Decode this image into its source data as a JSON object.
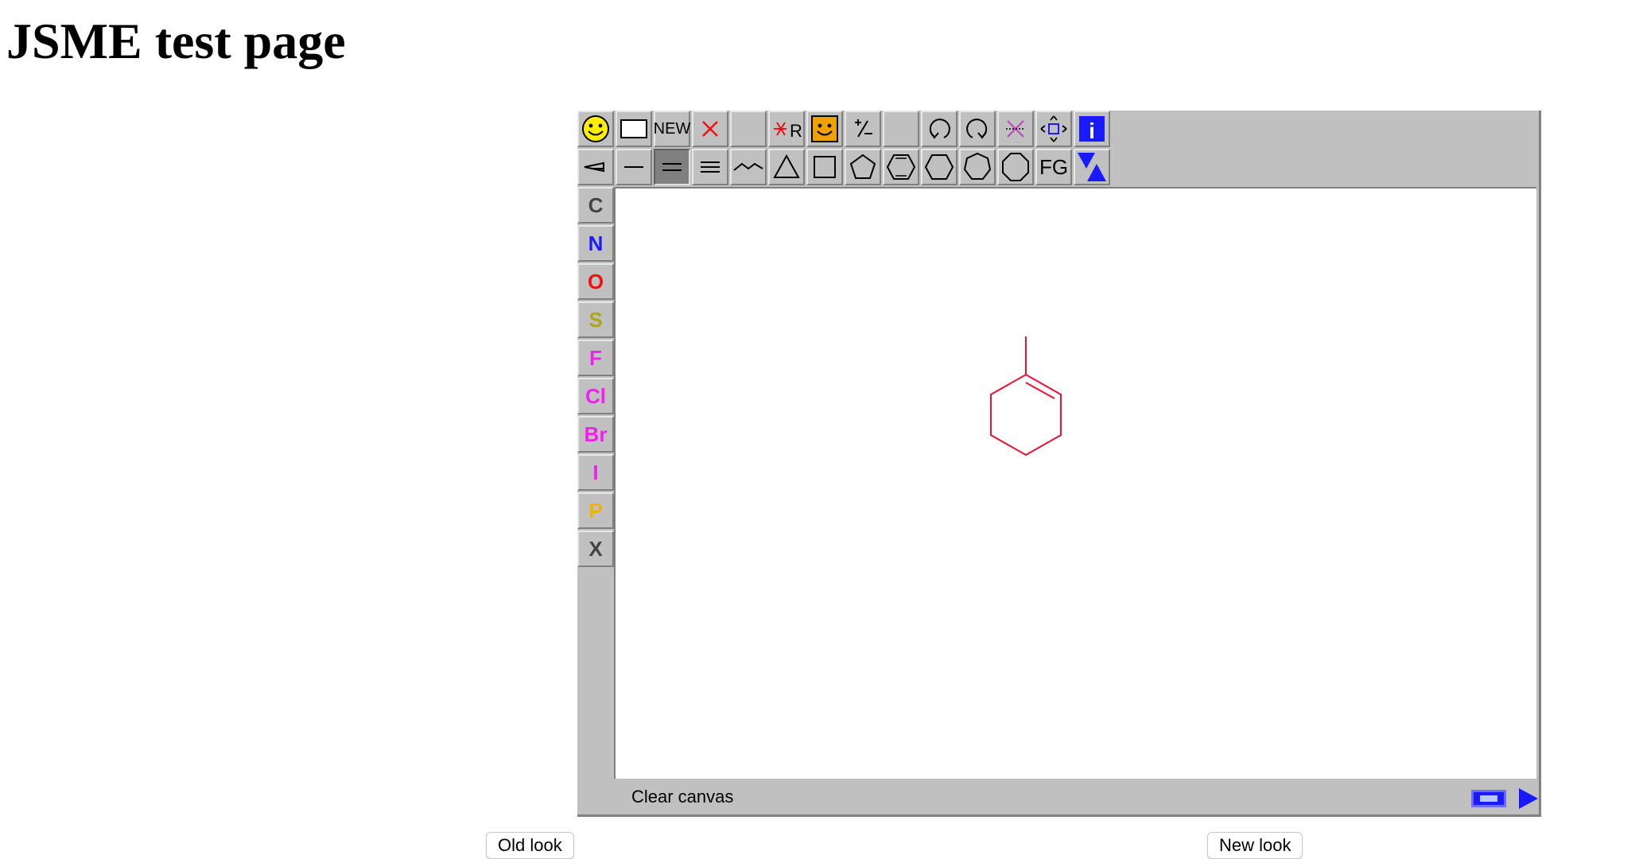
{
  "page": {
    "title": "JSME test page"
  },
  "editor": {
    "toolbar_row1": [
      {
        "name": "smiley-icon"
      },
      {
        "name": "blank-box-icon"
      },
      {
        "name": "new-button",
        "label": "NEW"
      },
      {
        "name": "delete-x-icon"
      },
      {
        "name": "empty-slot"
      },
      {
        "name": "delete-r-icon",
        "label": "R"
      },
      {
        "name": "query-smiley-icon"
      },
      {
        "name": "charge-icon"
      },
      {
        "name": "empty-slot"
      },
      {
        "name": "undo-icon"
      },
      {
        "name": "redo-icon"
      },
      {
        "name": "reaction-icon"
      },
      {
        "name": "move-icon"
      },
      {
        "name": "info-icon",
        "label": "i"
      }
    ],
    "toolbar_row2": [
      {
        "name": "wedge-bond-icon"
      },
      {
        "name": "single-bond-icon"
      },
      {
        "name": "double-bond-icon"
      },
      {
        "name": "triple-bond-icon"
      },
      {
        "name": "chain-icon"
      },
      {
        "name": "ring3-icon"
      },
      {
        "name": "ring4-icon"
      },
      {
        "name": "ring5-icon"
      },
      {
        "name": "benzene-icon"
      },
      {
        "name": "ring6-icon"
      },
      {
        "name": "ring7-icon"
      },
      {
        "name": "ring8-icon"
      },
      {
        "name": "fg-button",
        "label": "FG"
      },
      {
        "name": "triangles-icon"
      }
    ],
    "atoms": [
      {
        "symbol": "C",
        "color": "#444444"
      },
      {
        "symbol": "N",
        "color": "#1a1aff"
      },
      {
        "symbol": "O",
        "color": "#ee1111"
      },
      {
        "symbol": "S",
        "color": "#a8a81a"
      },
      {
        "symbol": "F",
        "color": "#ee22ee"
      },
      {
        "symbol": "Cl",
        "color": "#ee22ee"
      },
      {
        "symbol": "Br",
        "color": "#ee22ee"
      },
      {
        "symbol": "I",
        "color": "#ee22ee"
      },
      {
        "symbol": "P",
        "color": "#f0b400"
      },
      {
        "symbol": "X",
        "color": "#444444"
      }
    ],
    "molecule_color": "#ee1133",
    "status_text": "Clear canvas"
  },
  "buttons": {
    "old_look": "Old look",
    "new_look": "New look"
  }
}
